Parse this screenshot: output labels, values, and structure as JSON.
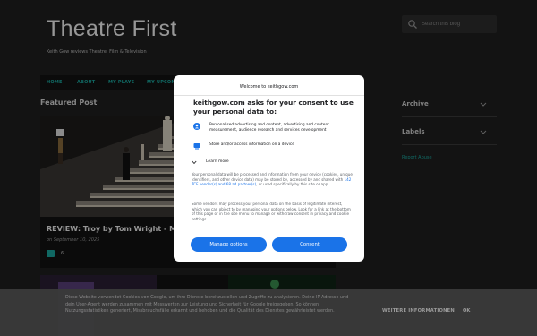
{
  "header": {
    "title": "Theatre First",
    "description": "Keith Gow reviews Theatre, Film & Television",
    "search_placeholder": "Search this blog"
  },
  "nav": {
    "items": [
      "HOME",
      "ABOUT",
      "MY PLAYS",
      "MY UPCOMI"
    ]
  },
  "featured": {
    "label": "Featured Post",
    "post_title": "REVIEW: Troy by Tom Wright - Malthou",
    "date": "on September 10, 2025",
    "comment_count": "6"
  },
  "sidebar": {
    "items": [
      "Archive",
      "Labels"
    ],
    "report_abuse": "Report Abuse"
  },
  "consent": {
    "site": "Welcome to keithgow.com",
    "heading": "keithgow.com asks for your consent to use your personal data to:",
    "purposes": [
      "Personalised advertising and content, advertising and content measurement, audience research and services development",
      "Store and/or access information on a device"
    ],
    "learn_more": "Learn more",
    "paragraph1_a": "Your personal data will be processed and information from your device (cookies, unique identifiers, and other device data) may be stored by, accessed by and shared with ",
    "paragraph1_link": "142 TCF vendor(s) and 68 ad partner(s)",
    "paragraph1_b": ", or used specifically by this site or app.",
    "paragraph2": "Some vendors may process your personal data on the basis of legitimate interest, which you can object to by managing your options below. Look for a link at the bottom of this page or in the site menu to manage or withdraw consent in privacy and cookie settings.",
    "manage_label": "Manage options",
    "consent_label": "Consent"
  },
  "cookie_bar": {
    "text": "Diese Website verwendet Cookies von Google, um ihre Dienste bereitzustellen und Zugriffe zu analysieren. Deine IP-Adresse und dein User-Agent werden zusammen mit Messwerten zur Leistung und Sicherheit für Google freigegeben. So können Nutzungsstatistiken generiert, Missbrauchsfälle erkannt und behoben und die Qualität des Dienstes gewährleistet werden.",
    "more_label": "WEITERE INFORMATIONEN",
    "ok_label": "OK"
  },
  "colors": {
    "accent": "#1ba9a0",
    "button_blue": "#1a73e8",
    "background": "#202020"
  }
}
